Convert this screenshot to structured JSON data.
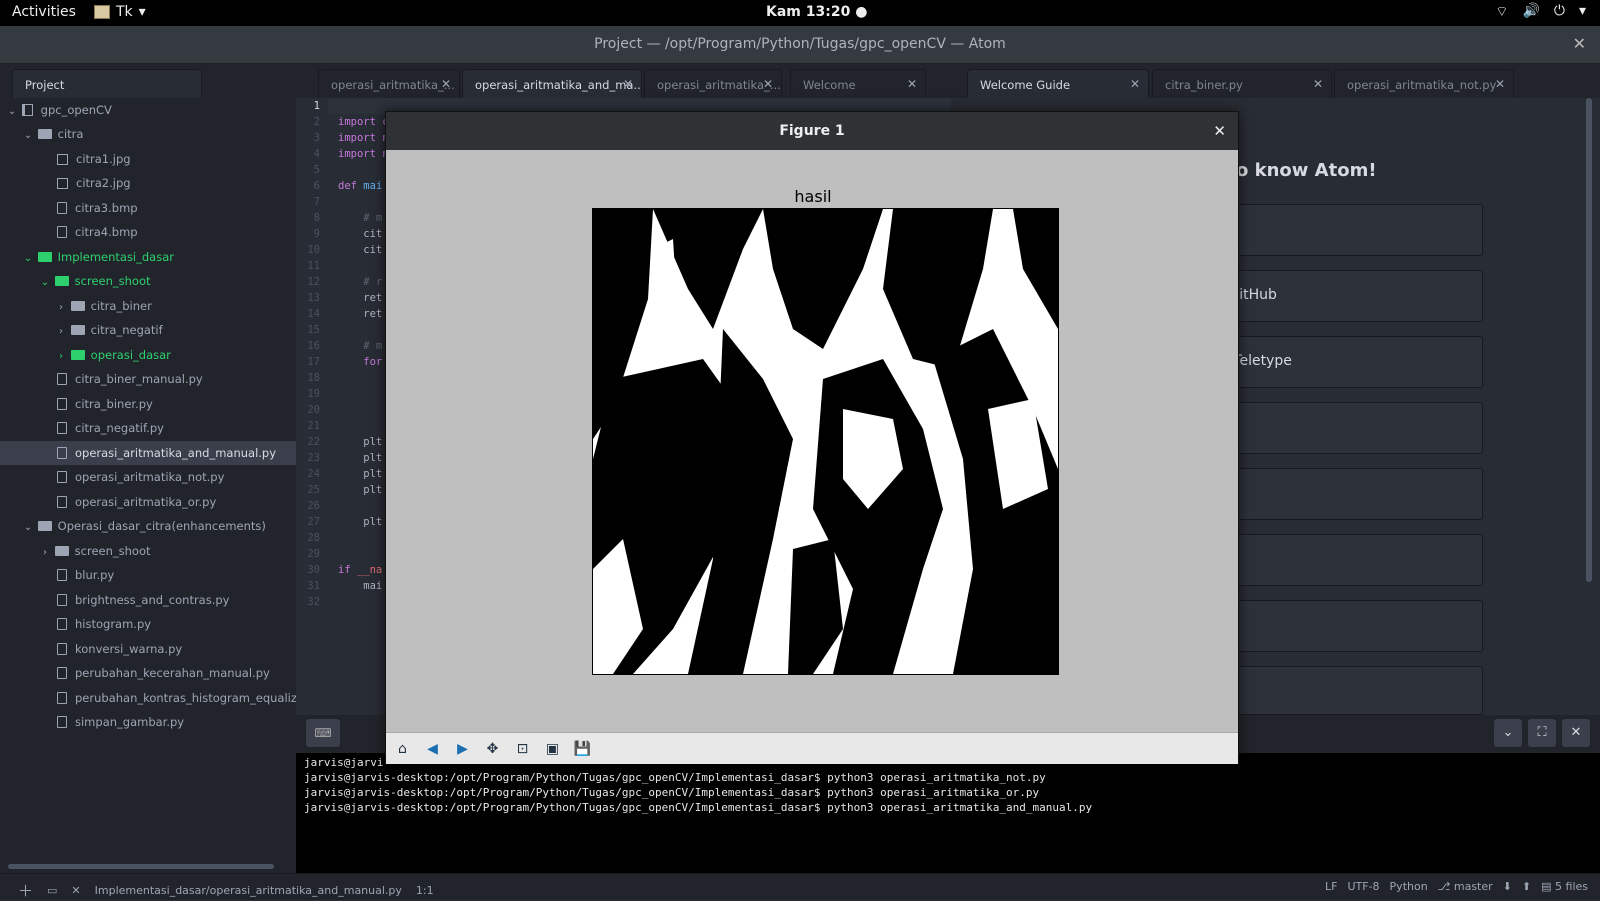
{
  "topbar": {
    "activities": "Activities",
    "app": "Tk",
    "clock": "Kam 13:20"
  },
  "window": {
    "title": "Project — /opt/Program/Python/Tugas/gpc_openCV — Atom"
  },
  "tabs": {
    "project": "Project",
    "t1": "operasi_aritmatika_...",
    "t2": "operasi_aritmatika_and_ma...",
    "t3": "operasi_aritmatika_...",
    "t4": "Welcome",
    "t5": "Welcome Guide",
    "t6": "citra_biner.py",
    "t7": "operasi_aritmatika_not.py"
  },
  "tree": {
    "root": "gpc_openCV",
    "citra": "citra",
    "citra1": "citra1.jpg",
    "citra2": "citra2.jpg",
    "citra3": "citra3.bmp",
    "citra4": "citra4.bmp",
    "impl": "Implementasi_dasar",
    "screen_shoot": "screen_shoot",
    "citra_biner_dir": "citra_biner",
    "citra_negatif_dir": "citra_negatif",
    "operasi_dasar": "operasi_dasar",
    "f1": "citra_biner_manual.py",
    "f2": "citra_biner.py",
    "f3": "citra_negatif.py",
    "f4": "operasi_aritmatika_and_manual.py",
    "f5": "operasi_aritmatika_not.py",
    "f6": "operasi_aritmatika_or.py",
    "enh": "Operasi_dasar_citra(enhancements)",
    "screen_shoot2": "screen_shoot",
    "g1": "blur.py",
    "g2": "brightness_and_contras.py",
    "g3": "histogram.py",
    "g4": "konversi_warna.py",
    "g5": "perubahan_kecerahan_manual.py",
    "g6": "perubahan_kontras_histogram_equalization",
    "g7": "simpan_gambar.py"
  },
  "code": {
    "l2": "import c",
    "l3": "import n",
    "l4": "import n",
    "l6a": "def ",
    "l6b": "mai",
    "l8": "    # m",
    "l9": "    cit",
    "l10": "    cit",
    "l12": "    # r",
    "l13": "    ret",
    "l14": "    ret",
    "l16": "    # m",
    "l17": "    for",
    "l22": "    plt",
    "l23": "    plt",
    "l24": "    plt",
    "l25": "    plt",
    "l27": "    plt",
    "l30a": "if ",
    "l30b": "__na",
    "l31": "    mai"
  },
  "guide": {
    "heading": "o know Atom!",
    "c2": "l GitHub",
    "c3": "n Teletype"
  },
  "figure": {
    "title": "Figure 1",
    "plot_title": "hasil"
  },
  "terminal": [
    "jarvis@jarvi",
    "jarvis@jarvis-desktop:/opt/Program/Python/Tugas/gpc_openCV/Implementasi_dasar$ python3 operasi_aritmatika_not.py",
    "jarvis@jarvis-desktop:/opt/Program/Python/Tugas/gpc_openCV/Implementasi_dasar$ python3 operasi_aritmatika_or.py",
    "jarvis@jarvis-desktop:/opt/Program/Python/Tugas/gpc_openCV/Implementasi_dasar$ python3 operasi_aritmatika_and_manual.py"
  ],
  "status": {
    "path": "Implementasi_dasar/operasi_aritmatika_and_manual.py",
    "cursor": "1:1",
    "eol": "LF",
    "encoding": "UTF-8",
    "grammar": "Python",
    "branch": "master",
    "files": "5 files"
  }
}
